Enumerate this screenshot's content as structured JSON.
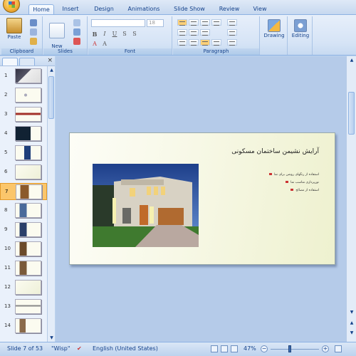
{
  "tabs": [
    "Home",
    "Insert",
    "Design",
    "Animations",
    "Slide Show",
    "Review",
    "View"
  ],
  "ribbon": {
    "clipboard": {
      "paste": "Paste",
      "label": "Clipboard"
    },
    "slides": {
      "new_slide": "New\nSlide",
      "label": "Slides"
    },
    "font": {
      "size": "18",
      "label": "Font"
    },
    "paragraph": {
      "label": "Paragraph"
    },
    "drawing": "Drawing",
    "editing": "Editing"
  },
  "thumbnails": [
    "1",
    "2",
    "3",
    "4",
    "5",
    "6",
    "7",
    "8",
    "9",
    "10",
    "11",
    "12",
    "13",
    "14"
  ],
  "selected_slide": "7",
  "slide": {
    "title": "آرایش نشیمن ساختمان مسکونی",
    "bullets": [
      "استفاده از رنگهای روشن برای نما",
      "نورپردازی مناسب نما",
      "استفاده از مصالح"
    ]
  },
  "status": {
    "slide_of": "Slide 7 of 53",
    "theme": "\"Wisp\"",
    "language": "English (United States)",
    "zoom": "47%"
  },
  "colors": {
    "accent": "#15428b",
    "ribbon": "#d6e4f6",
    "selected": "#fbc66b"
  }
}
